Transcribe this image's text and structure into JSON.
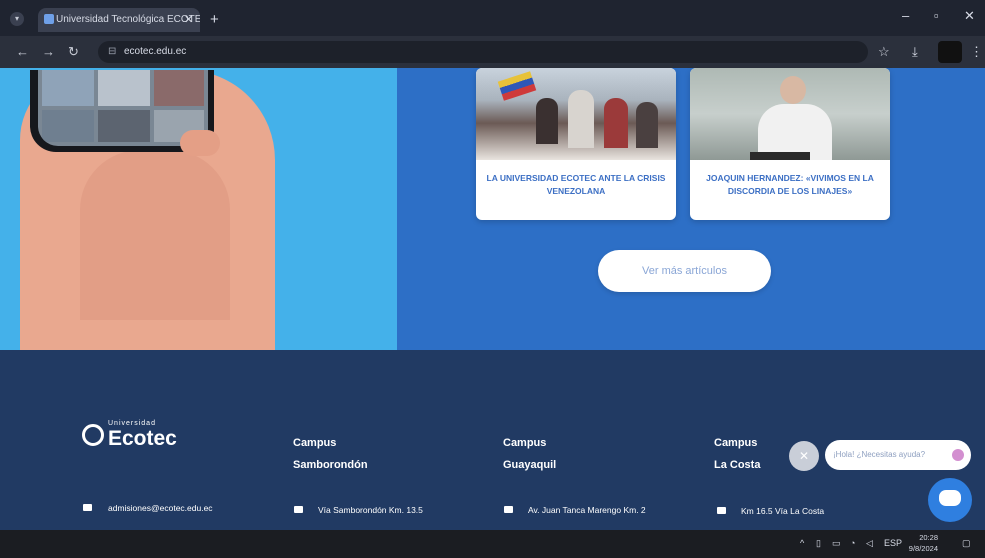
{
  "browser": {
    "tab_title": "Universidad Tecnológica ECOTEC",
    "tab_close": "✕",
    "new_tab": "+",
    "url": "ecotec.edu.ec",
    "icons": [
      "chevron-down-icon",
      "back-icon",
      "forward-icon",
      "reload-icon",
      "site-info-icon",
      "star-icon",
      "download-icon",
      "menu-icon",
      "minimize-icon",
      "maximize-icon",
      "close-icon"
    ],
    "window_buttons": {
      "minimize": "–",
      "maximize": "▫",
      "close": "✕"
    }
  },
  "articles": [
    {
      "title": "LA UNIVERSIDAD ECOTEC ANTE LA CRISIS VENEZOLANA"
    },
    {
      "title": "JOAQUIN HERNANDEZ: «VIVIMOS EN LA DISCORDIA DE LOS LINAJES»"
    }
  ],
  "more_button": "Ver más artículos",
  "footer": {
    "logo_small": "Universidad",
    "logo_name": "Ecotec",
    "campuses": [
      {
        "line1": "Campus",
        "line2": "Samborondón"
      },
      {
        "line1": "Campus",
        "line2": "Guayaquil"
      },
      {
        "line1": "Campus",
        "line2": "La Costa"
      }
    ],
    "contacts": [
      "admisiones@ecotec.edu.ec",
      "Vía Samborondón Km. 13.5",
      "Av. Juan Tanca Marengo Km. 2",
      "Km 16.5 Vía La Costa"
    ]
  },
  "chat": {
    "close": "✕",
    "prompt": "¡Hola! ¿Necesitas ayuda?"
  },
  "taskbar": {
    "language": "ESP",
    "time": "20:28",
    "date": "9/8/2024"
  },
  "colors": {
    "light_blue": "#44b1ea",
    "mid_blue": "#2d6fc6",
    "footer_navy": "#213a63",
    "chat_blue": "#2f7fe0"
  }
}
